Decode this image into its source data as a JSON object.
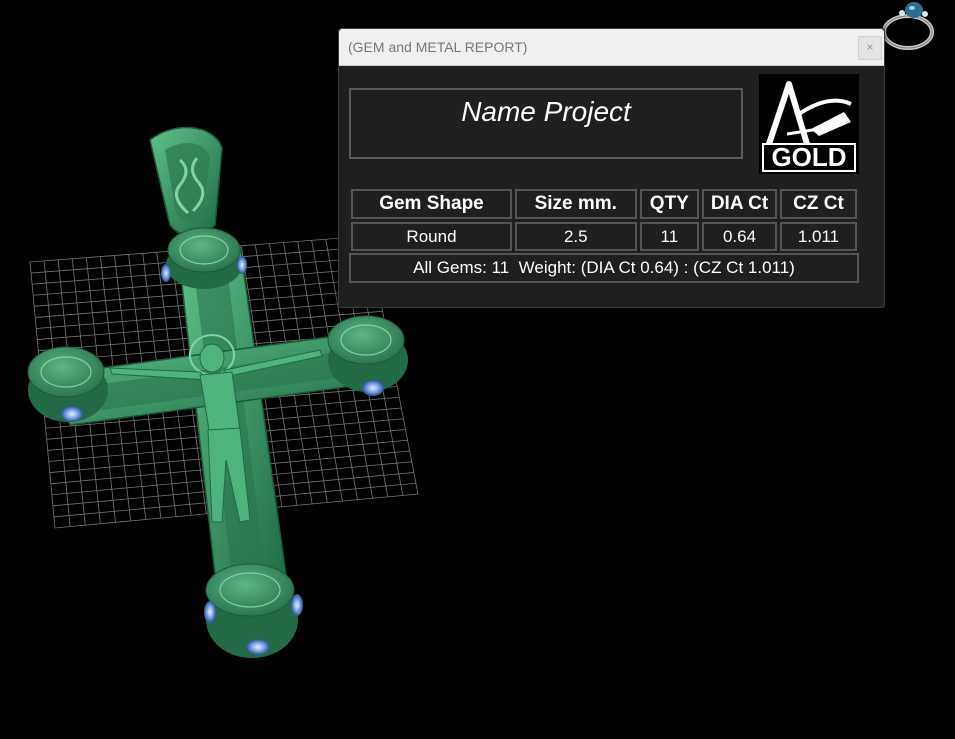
{
  "window": {
    "title": "(GEM and METAL REPORT)",
    "close_label": "×"
  },
  "project": {
    "name": "Name Project"
  },
  "logo": {
    "text": "GOLD"
  },
  "table": {
    "headers": [
      "Gem Shape",
      "Size mm.",
      "QTY",
      "DIA Ct",
      "CZ Ct"
    ],
    "rows": [
      [
        "Round",
        "2.5",
        "11",
        "0.64",
        "1.011"
      ]
    ]
  },
  "summary": {
    "text": "All Gems: 11  Weight: (DIA Ct 0.64) : (CZ Ct 1.011)"
  },
  "colors": {
    "background": "#000000",
    "panel": "#1f1f1f",
    "model_green": "#3e9a68",
    "gem_blue": "#6f9ee0",
    "grid": "#8a8a8a"
  },
  "icons": [
    "ring-icon",
    "cross-pendant-model",
    "close-icon"
  ]
}
